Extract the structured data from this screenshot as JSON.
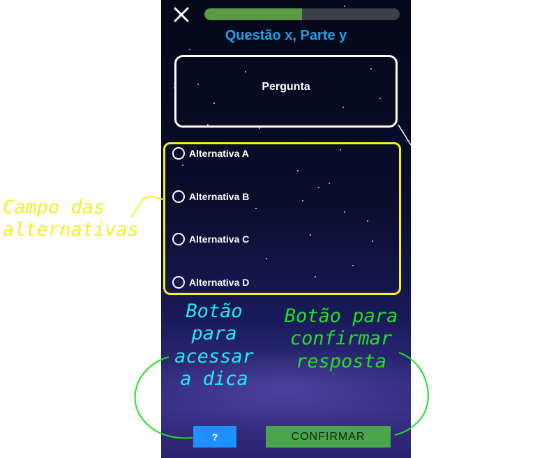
{
  "header": {
    "close_icon": "close-icon",
    "progress_fraction": 0.5,
    "title": "Questão x, Parte y"
  },
  "question": {
    "text": "Pergunta"
  },
  "options": [
    {
      "label": "Alternativa A"
    },
    {
      "label": "Alternativa B"
    },
    {
      "label": "Alternativa C"
    },
    {
      "label": "Alternativa D"
    }
  ],
  "footer": {
    "hint_label": "?",
    "confirm_label": "CONFIRMAR"
  },
  "annotations": {
    "options_field": "Campo das\nalternativas",
    "hint_button": "Botão\npara\nacessar\na dica",
    "confirm_button": "Botão para\nconfirmar\nresposta"
  },
  "colors": {
    "title": "#1ea0e6",
    "progress_fill": "#5b9a44",
    "options_border": "#f4f02a",
    "hint_button": "#1e90ff",
    "confirm_button": "#4aa64a",
    "annotation_yellow": "#f6ee22",
    "annotation_cyan": "#22ecf2",
    "annotation_green": "#22e022"
  }
}
